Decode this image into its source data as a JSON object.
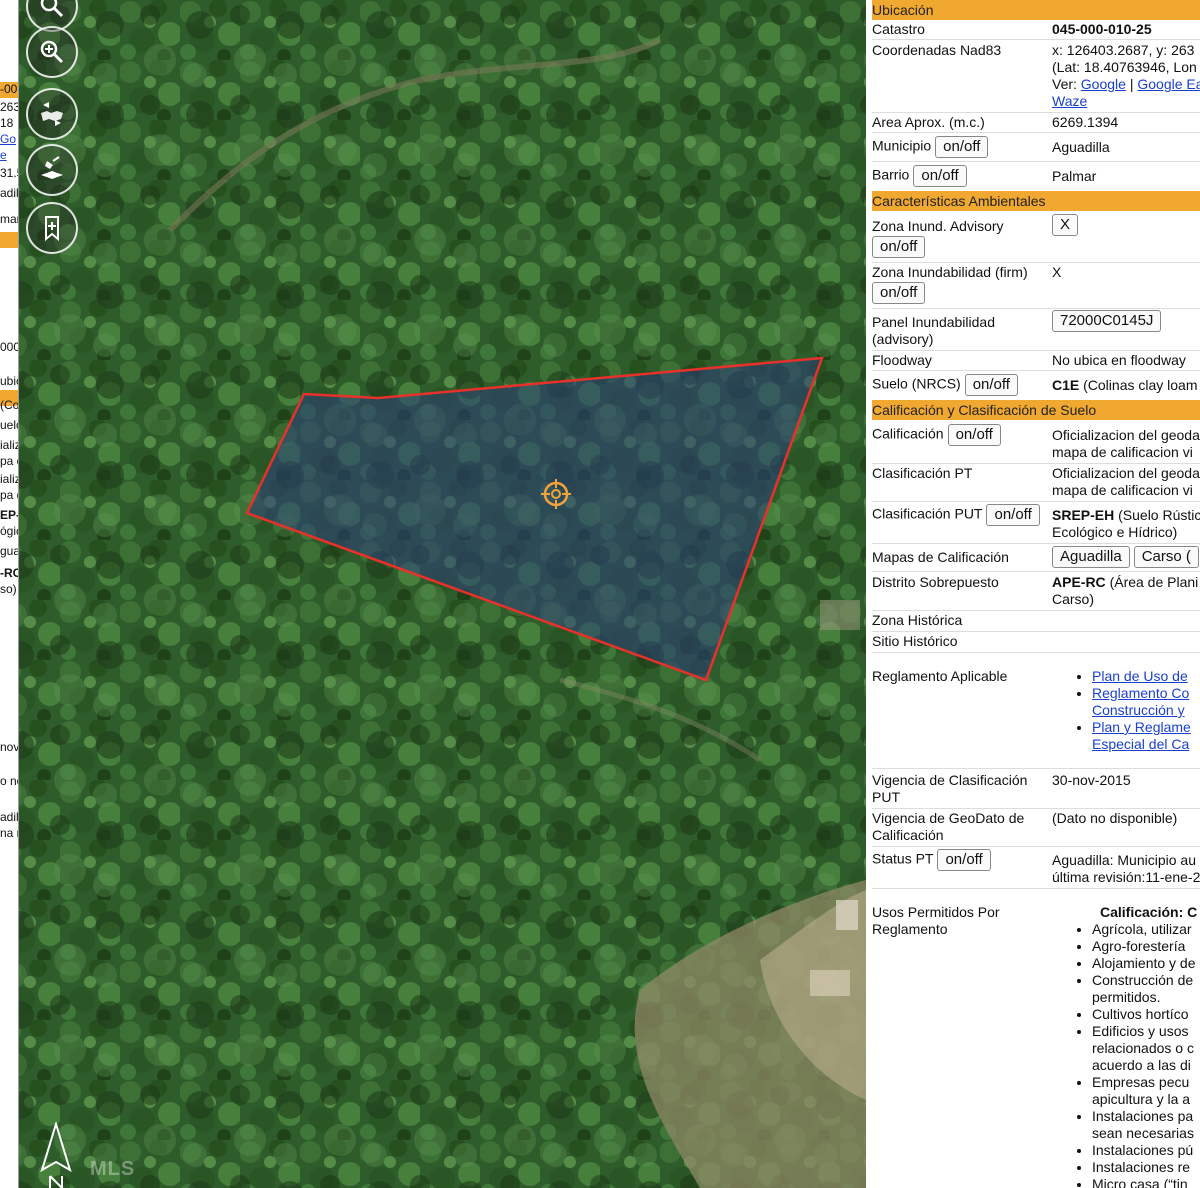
{
  "map": {
    "tools": [
      "zoom-out-icon",
      "zoom-in-icon",
      "map-swap-icon",
      "layer-satellite-icon",
      "add-bookmark-icon"
    ],
    "watermark": "MLS",
    "left_panel_fragments": [
      "-00",
      "263",
      "18",
      "Go",
      "e",
      "31.5",
      "adil",
      "mar",
      "000",
      "ubic",
      "(Co",
      "uelo",
      "ializ",
      "pa d",
      "ializ",
      "pa d",
      "EP-F",
      "ógic",
      "gua",
      "-RC",
      "so)",
      "nov-",
      "o no",
      "adil",
      "na r"
    ]
  },
  "panel": {
    "ubicacion": {
      "header": "Ubicación",
      "catastro_label": "Catastro",
      "catastro_value": "045-000-010-25",
      "coords_label": "Coordenadas Nad83",
      "coords_line1": "x: 126403.2687, y: 263",
      "coords_line2": "(Lat: 18.40763946, Lon",
      "ver_label": "Ver:",
      "link_google": "Google",
      "link_google_earth": "Google Ea",
      "link_waze": "Waze",
      "area_label": "Area Aprox. (m.c.)",
      "area_value": "6269.1394",
      "municipio_label": "Municipio",
      "municipio_value": "Aguadilla",
      "barrio_label": "Barrio",
      "barrio_value": "Palmar"
    },
    "ambientales": {
      "header": "Características Ambientales",
      "zona_inund_label": "Zona Inund. Advisory",
      "zona_inund_value": "X",
      "zona_firm_label": "Zona Inundabilidad (firm)",
      "zona_firm_value": "X",
      "panel_label_1": "Panel Inundabilidad",
      "panel_label_2": "(advisory)",
      "panel_value": "72000C0145J",
      "floodway_label": "Floodway",
      "floodway_value": "No ubica en floodway",
      "suelo_label": "Suelo (NRCS)",
      "suelo_code": "C1E",
      "suelo_desc": "(Colinas clay loam"
    },
    "calificacion": {
      "header": "Calificación y Clasificación de Suelo",
      "calif_label": "Calificación",
      "calif_value_1": "Oficializacion del geoda",
      "calif_value_2": "mapa de calificacion vi",
      "clasif_pt_label": "Clasificación PT",
      "clasif_pt_value_1": "Oficializacion del geoda",
      "clasif_pt_value_2": "mapa de calificacion vi",
      "clasif_put_label": "Clasificación PUT",
      "clasif_put_code": "SREP-EH",
      "clasif_put_desc_1": "(Suelo Rústic",
      "clasif_put_desc_2": "Ecológico e Hídrico)",
      "mapas_label": "Mapas de Calificación",
      "mapas_btn_1": "Aguadilla",
      "mapas_btn_2": "Carso (",
      "distrito_label": "Distrito Sobrepuesto",
      "distrito_code": "APE-RC",
      "distrito_desc_1": "(Área de Plani",
      "distrito_desc_2": "Carso)",
      "zona_hist_label": "Zona Histórica",
      "sitio_hist_label": "Sitio Histórico",
      "reglamento_label": "Reglamento Aplicable",
      "reglamento_links": [
        "Plan de Uso de",
        "Reglamento Co",
        "Construcción y",
        "Plan y Reglame",
        "Especial del Ca"
      ],
      "vigencia_put_label_1": "Vigencia de Clasificación",
      "vigencia_put_label_2": "PUT",
      "vigencia_put_value": "30-nov-2015",
      "vigencia_geo_label_1": "Vigencia de GeoDato de",
      "vigencia_geo_label_2": "Calificación",
      "vigencia_geo_value": "(Dato no disponible)",
      "status_label": "Status PT",
      "status_value_1": "Aguadilla: Municipio au",
      "status_value_2": "última revisión:11-ene-2",
      "usos_label_1": "Usos Permitidos Por",
      "usos_label_2": "Reglamento",
      "usos_title": "Calificación: C",
      "usos_items": [
        "Agrícola, utilizar",
        "Agro-forestería",
        "Alojamiento y de",
        "Construcción de",
        "permitidos.",
        "Cultivos hortíco",
        "Edificios y usos",
        "relacionados o c",
        "acuerdo a las di",
        "Empresas pecu",
        "apicultura y la a",
        "Instalaciones pa",
        "sean necesarias",
        "Instalaciones pú",
        "Instalaciones re",
        "Micro casa (“tin"
      ]
    },
    "toggle_label": "on/off"
  }
}
